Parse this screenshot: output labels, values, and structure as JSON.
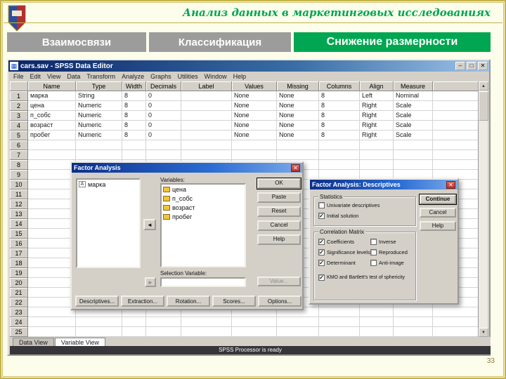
{
  "slide": {
    "title": "Анализ данных в маркетинговых исследованиях",
    "page_number": "33",
    "tabs": [
      {
        "label": "Взаимосвязи",
        "active": false
      },
      {
        "label": "Классификация",
        "active": false
      },
      {
        "label": "Снижение размерности",
        "active": true
      }
    ],
    "colors": {
      "accent_green": "#00A651",
      "tab_gray": "#9C9C9C",
      "background": "#FDFDEC",
      "border_gold": "#C3B24E"
    }
  },
  "spss": {
    "window_title": "cars.sav - SPSS Data Editor",
    "menu": [
      "File",
      "Edit",
      "View",
      "Data",
      "Transform",
      "Analyze",
      "Graphs",
      "Utilities",
      "Window",
      "Help"
    ],
    "icons": {
      "app": "▦",
      "minimize": "–",
      "maximize": "□",
      "close": "✕",
      "scroll_up": "▲",
      "scroll_down": "▼",
      "transfer_arrow": "◄",
      "selection_arrow": "►",
      "string_var": "A"
    },
    "grid": {
      "columns": [
        "Name",
        "Type",
        "Width",
        "Decimals",
        "Label",
        "Values",
        "Missing",
        "Columns",
        "Align",
        "Measure"
      ],
      "rows": [
        [
          "марка",
          "String",
          "8",
          "0",
          "",
          "None",
          "None",
          "8",
          "Left",
          "Nominal"
        ],
        [
          "цена",
          "Numeric",
          "8",
          "0",
          "",
          "None",
          "None",
          "8",
          "Right",
          "Scale"
        ],
        [
          "п_собс",
          "Numeric",
          "8",
          "0",
          "",
          "None",
          "None",
          "8",
          "Right",
          "Scale"
        ],
        [
          "возраст",
          "Numeric",
          "8",
          "0",
          "",
          "None",
          "None",
          "8",
          "Right",
          "Scale"
        ],
        [
          "пробег",
          "Numeric",
          "8",
          "0",
          "",
          "None",
          "None",
          "8",
          "Right",
          "Scale"
        ]
      ],
      "row_count": 25
    },
    "sheet_tabs": [
      "Data View",
      "Variable View"
    ],
    "status": "SPSS Processor is ready"
  },
  "factor_dialog": {
    "title": "Factor Analysis",
    "source_items": [
      "марка"
    ],
    "variables_label": "Variables:",
    "variables": [
      "цена",
      "п_собс",
      "возраст",
      "пробег"
    ],
    "selection_label": "Selection Variable:",
    "value_button": "Value...",
    "buttons": [
      "OK",
      "Paste",
      "Reset",
      "Cancel",
      "Help"
    ],
    "bottom_buttons": [
      "Descriptives...",
      "Extraction...",
      "Rotation...",
      "Scores...",
      "Options..."
    ]
  },
  "descriptives_dialog": {
    "title": "Factor Analysis: Descriptives",
    "statistics_group": "Statistics",
    "statistics": [
      {
        "label": "Univariate descriptives",
        "checked": false,
        "mark": ""
      },
      {
        "label": "Initial solution",
        "checked": true,
        "mark": "✓"
      }
    ],
    "correlation_group": "Correlation Matrix",
    "correlation_left": [
      {
        "label": "Coefficients",
        "checked": true,
        "mark": "✓"
      },
      {
        "label": "Significance levels",
        "checked": true,
        "mark": "✓"
      },
      {
        "label": "Determinant",
        "checked": true,
        "mark": "✓"
      }
    ],
    "correlation_right": [
      {
        "label": "Inverse",
        "checked": false,
        "mark": ""
      },
      {
        "label": "Reproduced",
        "checked": false,
        "mark": ""
      },
      {
        "label": "Anti-image",
        "checked": false,
        "mark": ""
      }
    ],
    "kmo": {
      "label": "KMO and Bartlett's test of sphericity",
      "checked": true,
      "mark": "✓"
    },
    "buttons": [
      "Continue",
      "Cancel",
      "Help"
    ]
  }
}
